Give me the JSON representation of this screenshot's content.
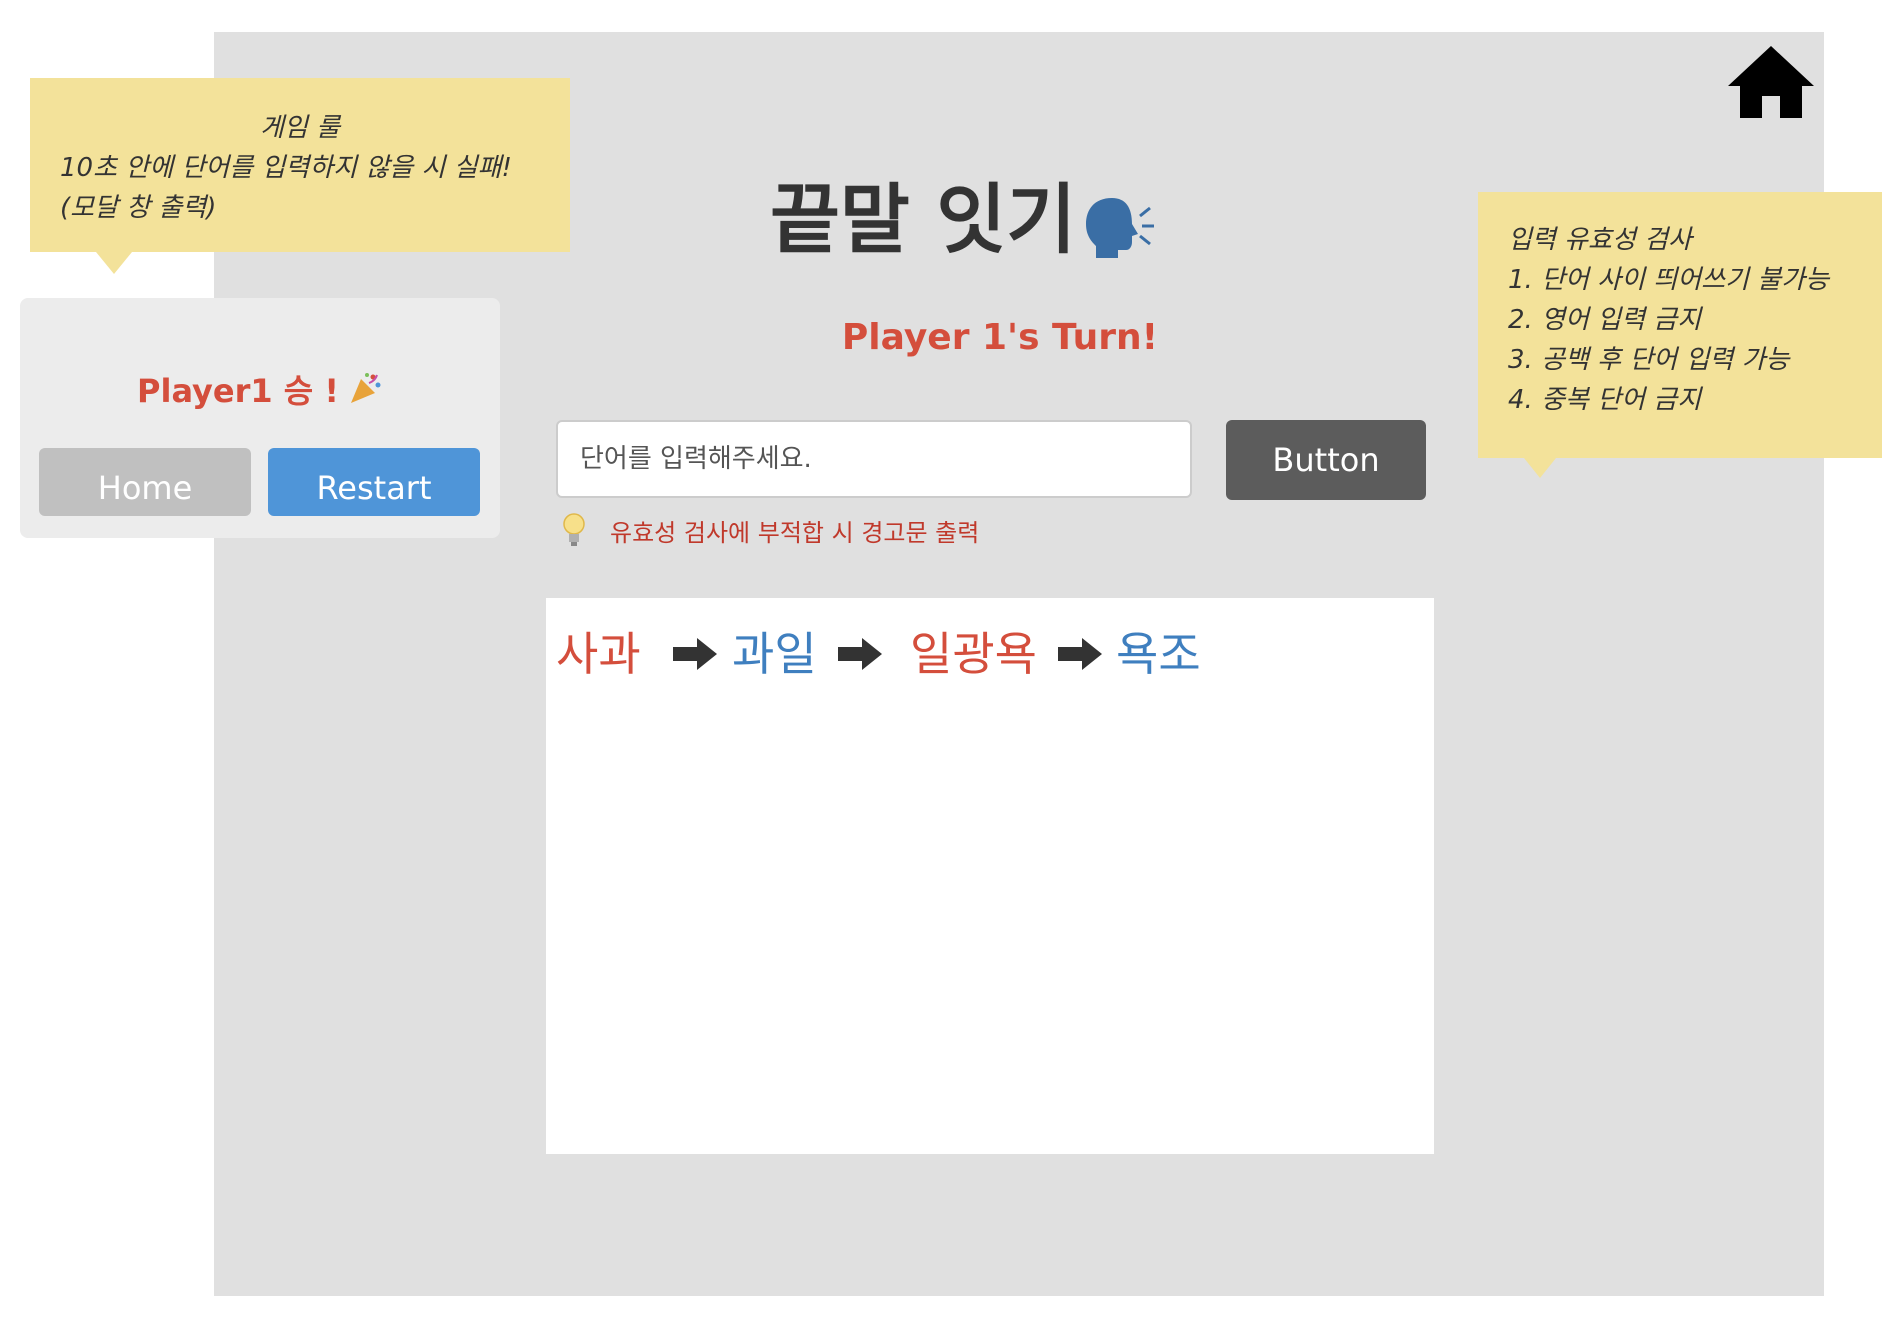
{
  "game": {
    "title": "끝말 잇기",
    "turn_text": "Player 1's Turn!",
    "input_placeholder": "단어를 입력해주세요.",
    "button_label": "Button",
    "hint_text": "유효성 검사에 부적합 시 경고문 출력"
  },
  "chain": [
    {
      "word": "사과",
      "color": "#d44e3c"
    },
    {
      "word": "과일",
      "color": "#3f7fbf"
    },
    {
      "word": "일광욕",
      "color": "#d44e3c"
    },
    {
      "word": "욕조",
      "color": "#3f7fbf"
    }
  ],
  "notes": {
    "rules": {
      "title": "게임 룰",
      "line1": "10초 안에 단어를 입력하지 않을 시 실패!",
      "line2": "(모달 창 출력)"
    },
    "validation": {
      "title": "입력 유효성 검사",
      "items": [
        "1. 단어 사이 띄어쓰기 불가능",
        "2. 영어 입력 금지",
        "3. 공백 후 단어 입력 가능",
        "4. 중복 단어 금지"
      ]
    }
  },
  "modal": {
    "message": "Player1 승 !",
    "home_label": "Home",
    "restart_label": "Restart"
  },
  "icons": {
    "home": "home-icon",
    "speaker": "speaking-head-icon",
    "bulb": "light-bulb-icon",
    "arrow": "right-arrow-icon",
    "party": "party-popper-icon"
  },
  "colors": {
    "accent_red": "#d44e3c",
    "accent_blue": "#3f7fbf",
    "note_yellow": "#f3e29a",
    "panel_gray": "#e0e0e0",
    "restart_blue": "#4f95d8"
  }
}
